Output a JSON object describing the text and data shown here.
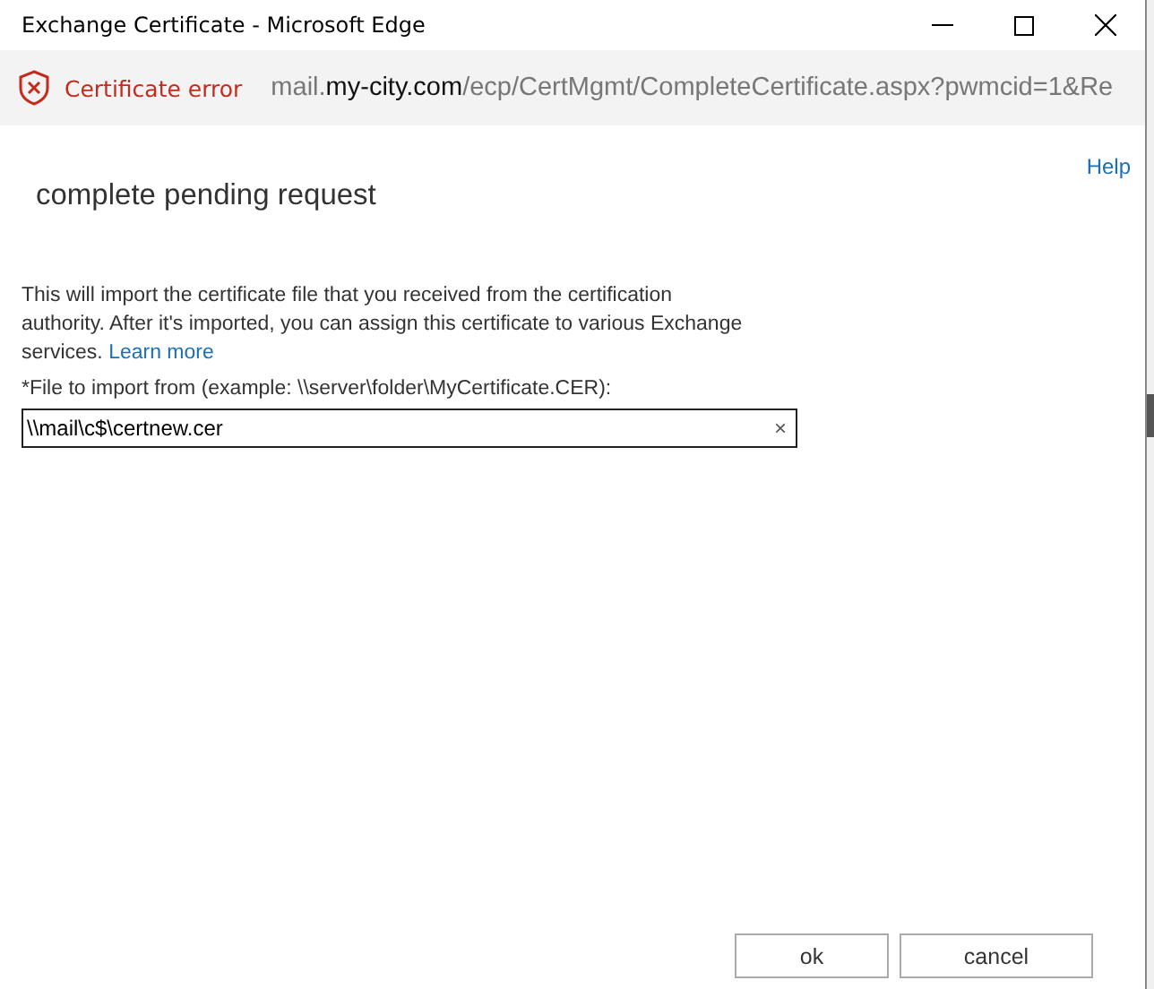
{
  "window": {
    "title": "Exchange Certificate - Microsoft Edge"
  },
  "address_bar": {
    "security_label": "Certificate error",
    "url_prefix": "mail.",
    "url_domain": "my-city.com",
    "url_path": "/ecp/CertMgmt/CompleteCertificate.aspx?pwmcid=1&Re"
  },
  "help_link": "Help",
  "heading": "complete pending request",
  "description": "This will import the certificate file that you received from the certification authority. After it's imported, you can assign this certificate to various Exchange services.",
  "learn_more_link": "Learn more",
  "file_field": {
    "label": "*File to import from (example: \\\\server\\folder\\MyCertificate.CER):",
    "value": "\\\\mail\\c$\\certnew.cer",
    "clear": "×"
  },
  "buttons": [
    "ok",
    "cancel"
  ]
}
